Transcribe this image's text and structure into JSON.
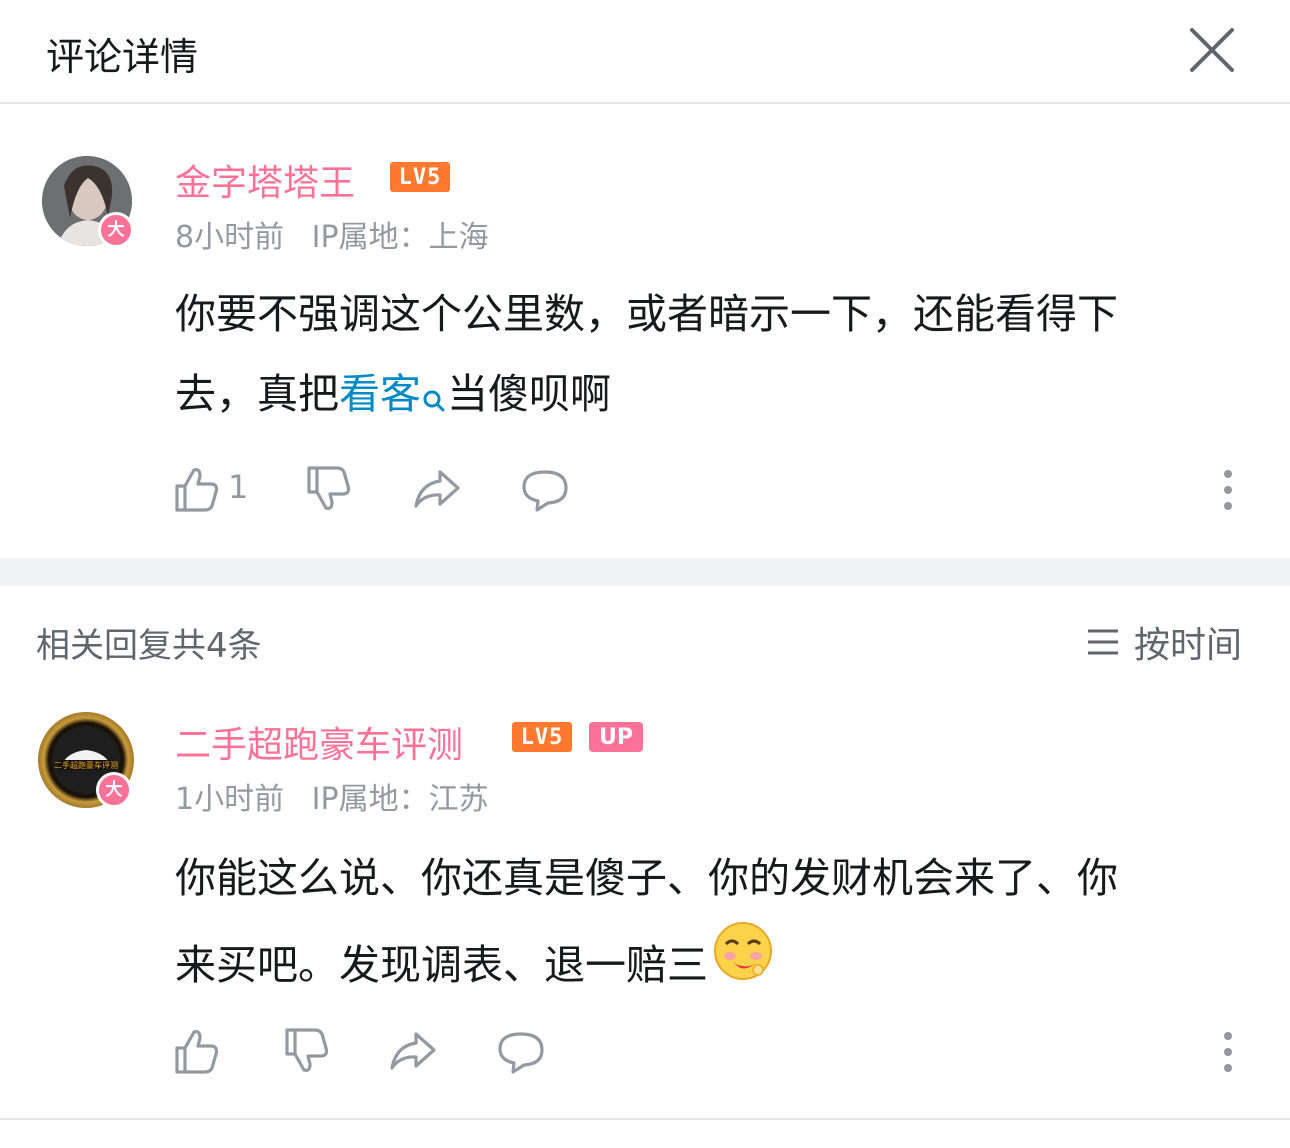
{
  "header": {
    "title": "评论详情"
  },
  "comment": {
    "username": "金字塔塔王",
    "level": "LV5",
    "badge": "大",
    "time": "8小时前",
    "ip": "IP属地：上海",
    "text_line1": "你要不强调这个公里数，或者暗示一下，还能看得下",
    "text_line2_before": "去，真把",
    "text_link": "看客",
    "text_line2_after": "当傻呗啊",
    "likes": "1"
  },
  "replies_header": {
    "count_label": "相关回复共4条",
    "sort_label": "按时间"
  },
  "reply": {
    "username": "二手超跑豪车评测",
    "level": "LV5",
    "up_badge": "UP",
    "badge": "大",
    "avatar_text": "二手超跑豪车评测",
    "time": "1小时前",
    "ip": "IP属地：江苏",
    "text_line1": "你能这么说、你还真是傻子、你的发财机会来了、你",
    "text_line2": "来买吧。发现调表、退一赔三"
  },
  "colors": {
    "accent": "#fb7299",
    "level": "#ff7a2e",
    "link": "#008ac5",
    "meta": "#9499a0"
  },
  "icons": [
    "close-icon",
    "thumbs-up-icon",
    "thumbs-down-icon",
    "share-icon",
    "comment-icon",
    "more-icon",
    "search-icon",
    "sort-icon",
    "emoji-icon"
  ]
}
